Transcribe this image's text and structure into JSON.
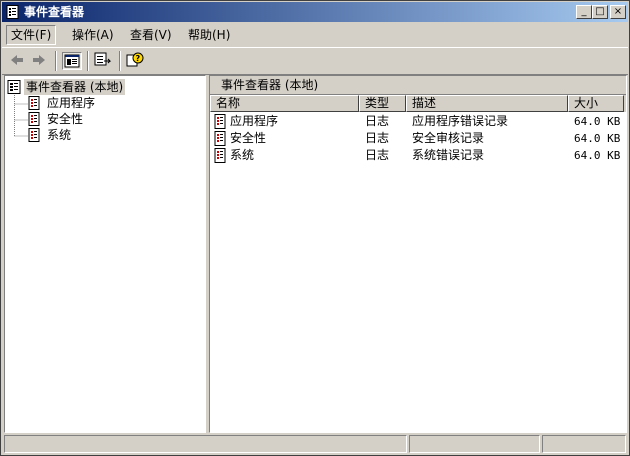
{
  "window": {
    "title": "事件查看器",
    "controls": {
      "minimize": "_",
      "maximize": "□",
      "close": "×"
    }
  },
  "menubar": {
    "items": [
      {
        "label": "文件(F)"
      },
      {
        "label": "操作(A)"
      },
      {
        "label": "查看(V)"
      },
      {
        "label": "帮助(H)"
      }
    ]
  },
  "toolbar": {
    "icons": [
      "back-arrow-icon",
      "forward-arrow-icon",
      "show-hide-console-tree-icon",
      "export-list-icon",
      "help-icon"
    ]
  },
  "tree": {
    "root": "事件查看器 (本地)",
    "children": [
      "应用程序",
      "安全性",
      "系统"
    ]
  },
  "list": {
    "header_title": "事件查看器 (本地)",
    "columns": [
      "名称",
      "类型",
      "描述",
      "大小"
    ],
    "rows": [
      {
        "name": "应用程序",
        "type": "日志",
        "desc": "应用程序错误记录",
        "size": "64.0 KB"
      },
      {
        "name": "安全性",
        "type": "日志",
        "desc": "安全审核记录",
        "size": "64.0 KB"
      },
      {
        "name": "系统",
        "type": "日志",
        "desc": "系统错误记录",
        "size": "64.0 KB"
      }
    ]
  },
  "colors": {
    "title_start": "#0a246a",
    "title_end": "#a6caf0",
    "face": "#d4d0c8"
  }
}
